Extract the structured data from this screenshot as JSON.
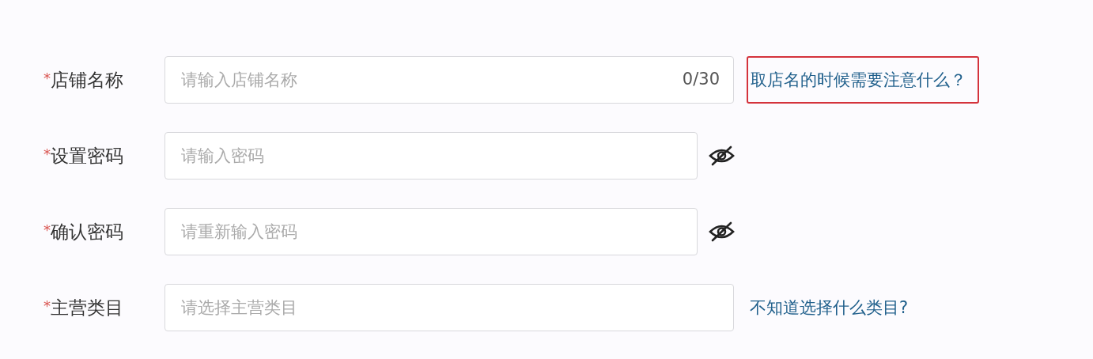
{
  "fields": [
    {
      "kind": "text",
      "marker": "*",
      "label": "店铺名称",
      "placeholder": "请输入店铺名称",
      "counter": "0/30",
      "help": {
        "text": "取店名的时候需要注意什么？",
        "highlighted": true
      }
    },
    {
      "kind": "password",
      "marker": "*",
      "label": "设置密码",
      "placeholder": "请输入密码"
    },
    {
      "kind": "password",
      "marker": "*",
      "label": "确认密码",
      "placeholder": "请重新输入密码"
    },
    {
      "kind": "select",
      "marker": "*",
      "label": "主营类目",
      "placeholder": "请选择主营类目",
      "help": {
        "text": "不知道选择什么类目?",
        "highlighted": false
      }
    }
  ]
}
